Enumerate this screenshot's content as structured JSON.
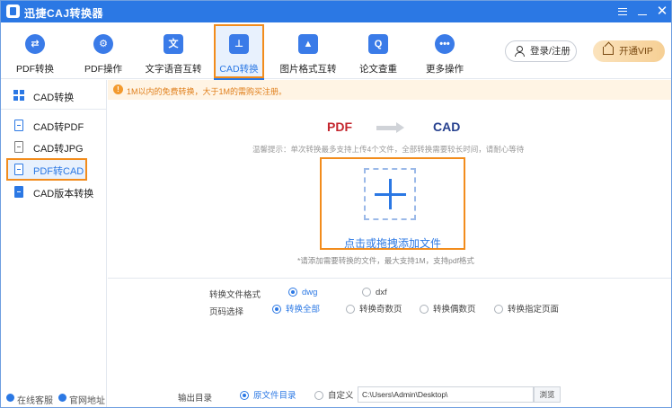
{
  "app": {
    "title": "迅捷CAJ转换器",
    "accent_color": "#2b78e4",
    "highlight_color": "#f28c1c"
  },
  "window_controls": [
    "menu-icon",
    "minimize-icon",
    "close-icon"
  ],
  "toolbar": {
    "items": [
      {
        "label": "PDF转换",
        "icon": "pdf-convert-icon"
      },
      {
        "label": "PDF操作",
        "icon": "gear-icon"
      },
      {
        "label": "文字语音互转",
        "icon": "text-speech-icon"
      },
      {
        "label": "CAD转换",
        "icon": "cad-icon",
        "active": true
      },
      {
        "label": "图片格式互转",
        "icon": "image-icon"
      },
      {
        "label": "论文查重",
        "icon": "search-doc-icon"
      },
      {
        "label": "更多操作",
        "icon": "more-icon"
      }
    ],
    "login_label": "登录/注册",
    "vip_label": "开通VIP"
  },
  "sidebar": {
    "header": "CAD转换",
    "items": [
      {
        "label": "CAD转PDF",
        "icon": "pdf-file-icon"
      },
      {
        "label": "CAD转JPG",
        "icon": "jpg-file-icon"
      },
      {
        "label": "PDF转CAD",
        "icon": "pdf-file-icon",
        "active": true
      },
      {
        "label": "CAD版本转换",
        "icon": "cad-file-icon"
      }
    ],
    "online_service": "在线客服",
    "official_site": "官网地址"
  },
  "notice": "1M以内的免费转换，大于1M的需购买注册。",
  "flow": {
    "from": "PDF",
    "to": "CAD"
  },
  "tip": "温馨提示：单次转换最多支持上传4个文件，全部转换需要较长时间，请耐心等待",
  "dropzone": {
    "label": "点击或拖拽添加文件"
  },
  "support_text": "*请添加需要转换的文件，最大支持1M，支持pdf格式",
  "options": {
    "format_label": "转换文件格式",
    "formats": [
      {
        "label": "dwg",
        "selected": true
      },
      {
        "label": "dxf",
        "selected": false
      }
    ],
    "page_label": "页码选择",
    "pages": [
      {
        "label": "转换全部",
        "selected": true
      },
      {
        "label": "转换奇数页",
        "selected": false
      },
      {
        "label": "转换偶数页",
        "selected": false
      },
      {
        "label": "转换指定页面",
        "selected": false
      }
    ]
  },
  "output": {
    "label": "输出目录",
    "choices": [
      {
        "label": "原文件目录",
        "selected": true
      },
      {
        "label": "自定义",
        "selected": false
      }
    ],
    "path": "C:\\Users\\Admin\\Desktop\\",
    "browse_label": "浏览"
  }
}
